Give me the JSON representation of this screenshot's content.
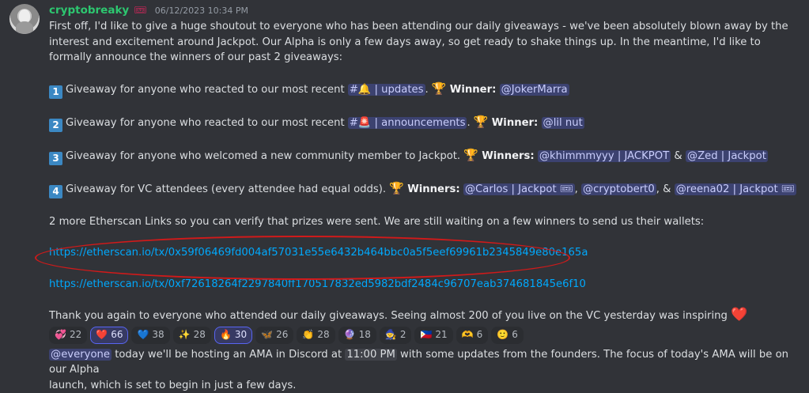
{
  "message": {
    "username": "cryptobreaky",
    "badge_icon": "ticket-icon",
    "timestamp": "06/12/2023 10:34 PM",
    "intro": "First off, I'd like to give a huge shoutout to everyone who has been attending our daily giveaways - we've been absolutely blown away by the interest and excitement around Jackpot. Our Alpha is only a few days away, so get ready to shake things up. In the meantime, I'd like to formally announce the winners of our past 2 giveaways:",
    "items": [
      {
        "num": "1",
        "text": "Giveaway for anyone who reacted to our most recent",
        "channel_icon": "#🔔",
        "channel": "| updates",
        "winners_label": "Winner:",
        "winners": [
          "@JokerMarra"
        ]
      },
      {
        "num": "2",
        "text": "Giveaway for anyone who reacted to our most recent",
        "channel_icon": "#🚨",
        "channel": "| announcements",
        "winners_label": "Winner:",
        "winners": [
          "@lil nut"
        ]
      },
      {
        "num": "3",
        "text": "Giveaway for anyone who welcomed a new community member to Jackpot.",
        "winners_label": "Winners:",
        "winners": [
          "@khimmmyyy | JACKPOT",
          "@Zed | Jackpot"
        ],
        "sep": "&"
      },
      {
        "num": "4",
        "text": "Giveaway for VC attendees (every attendee had equal odds).",
        "winners_label": "Winners:",
        "winners": [
          "@Carlos | Jackpot 🎟",
          "@cryptobert0",
          "@reena02 | Jackpot 🎟"
        ],
        "sep1": ",",
        "sep2": ", &"
      }
    ],
    "etherscan_note": "2 more Etherscan Links so you can verify that prizes were sent. We are still waiting on a few winners to send us their wallets:",
    "link1": "https://etherscan.io/tx/0x59f06469fd004af57031e55e6432b464bbc0a5f5eef69961b2345849e80e165a",
    "link2": "https://etherscan.io/tx/0xf72618264f2297840ff170517832ed5982bdf2484c96707eab374681845e6f10",
    "thanks": "Thank you again to everyone who attended our daily giveaways. Seeing almost 200 of you live on the VC yesterday was inspiring",
    "reactions": [
      {
        "emoji": "💞",
        "count": "22",
        "icon": "revolving-hearts-icon"
      },
      {
        "emoji": "❤️",
        "count": "66",
        "icon": "red-heart-icon",
        "active": true
      },
      {
        "emoji": "💙",
        "count": "38",
        "icon": "blue-heart-icon"
      },
      {
        "emoji": "✨",
        "count": "28",
        "icon": "sparkles-icon"
      },
      {
        "emoji": "🔥",
        "count": "30",
        "icon": "fire-icon",
        "active": true
      },
      {
        "emoji": "🦋",
        "count": "26",
        "icon": "butterfly-icon"
      },
      {
        "emoji": "👏",
        "count": "28",
        "icon": "clap-icon"
      },
      {
        "emoji": "🔮",
        "count": "18",
        "icon": "crystal-ball-icon"
      },
      {
        "emoji": "🧙",
        "count": "2",
        "icon": "wizard-icon"
      },
      {
        "emoji": "🇵🇭",
        "count": "21",
        "icon": "flag-icon"
      },
      {
        "emoji": "🫶",
        "count": "6",
        "icon": "heart-hands-icon"
      },
      {
        "emoji": "🙂",
        "count": "6",
        "icon": "smile-icon"
      }
    ],
    "everyone": "@everyone",
    "ama_a": " today we'll be hosting an AMA in Discord at",
    "ama_time": "11:00 PM",
    "ama_b": " with some updates from the founders. The focus of today's AMA will be on our Alpha",
    "ama_c": "launch, which is set to begin in just a few days."
  }
}
